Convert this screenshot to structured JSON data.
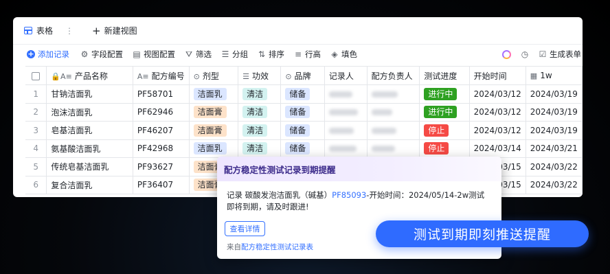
{
  "view_bar": {
    "tab_label": "表格",
    "tab_menu": "⋮",
    "new_view_label": "新建视图"
  },
  "toolbar": {
    "add_record": "添加记录",
    "field_config": "字段配置",
    "view_config": "视图配置",
    "filter": "筛选",
    "group": "分组",
    "sort": "排序",
    "row_height": "行高",
    "fill": "填色",
    "generate_form": "生成表单"
  },
  "table": {
    "columns": [
      "产品名称",
      "配方编号",
      "剂型",
      "功效",
      "品牌",
      "记录人",
      "配方负责人",
      "测试进度",
      "开始时间",
      "1w"
    ],
    "rows": [
      {
        "idx": "1",
        "name": "甘钠洁面乳",
        "code": "PF58701",
        "form": "洁面乳",
        "form_type": "milk",
        "effect": "清洁",
        "brand": "储备",
        "progress": "进行中",
        "progress_type": "progress",
        "start": "2024/03/12",
        "w1": "2024/03/19"
      },
      {
        "idx": "2",
        "name": "泡沫洁面乳",
        "code": "PF62946",
        "form": "洁面膏",
        "form_type": "paste",
        "effect": "清洁",
        "brand": "储备",
        "progress": "进行中",
        "progress_type": "progress",
        "start": "2024/03/12",
        "w1": "2024/03/19"
      },
      {
        "idx": "3",
        "name": "皂基洁面乳",
        "code": "PF46207",
        "form": "洁面膏",
        "form_type": "paste",
        "effect": "清洁",
        "brand": "储备",
        "progress": "停止",
        "progress_type": "stop",
        "start": "2024/03/12",
        "w1": "2024/03/19"
      },
      {
        "idx": "4",
        "name": "氨基酸洁面乳",
        "code": "PF42968",
        "form": "洁面乳",
        "form_type": "milk",
        "effect": "清洁",
        "brand": "储备",
        "progress": "停止",
        "progress_type": "stop",
        "start": "2024/03/14",
        "w1": "2024/03/21"
      },
      {
        "idx": "5",
        "name": "传统皂基洁面乳",
        "code": "PF93627",
        "form": "洁面膏",
        "form_type": "paste",
        "effect": "",
        "brand": "",
        "progress": "",
        "progress_type": "",
        "start": "2024/03/15",
        "w1": "2024/03/22"
      },
      {
        "idx": "6",
        "name": "复合洁面乳",
        "code": "PF36407",
        "form": "洁面膏",
        "form_type": "paste",
        "effect": "",
        "brand": "",
        "progress": "",
        "progress_type": "",
        "start": "2024/03/15",
        "w1": "2024/03/22"
      }
    ]
  },
  "popup": {
    "title": "配方稳定性测试记录到期提醒",
    "body_prefix": "记录 碳酸发泡洁面乳（碱基）",
    "body_link": "PF85093",
    "body_suffix": "-开始时间：2024/05/14-2w测试即将到期，请及时跟进!",
    "button": "查看详情",
    "from_prefix": "来自",
    "from_link": "配方稳定性测试记录表"
  },
  "banner": {
    "text": "测试到期即刻推送提醒"
  },
  "colors": {
    "accent": "#3370ff",
    "progress": "#2ea121",
    "stop": "#f54a45",
    "banner": "#2f6bff"
  }
}
